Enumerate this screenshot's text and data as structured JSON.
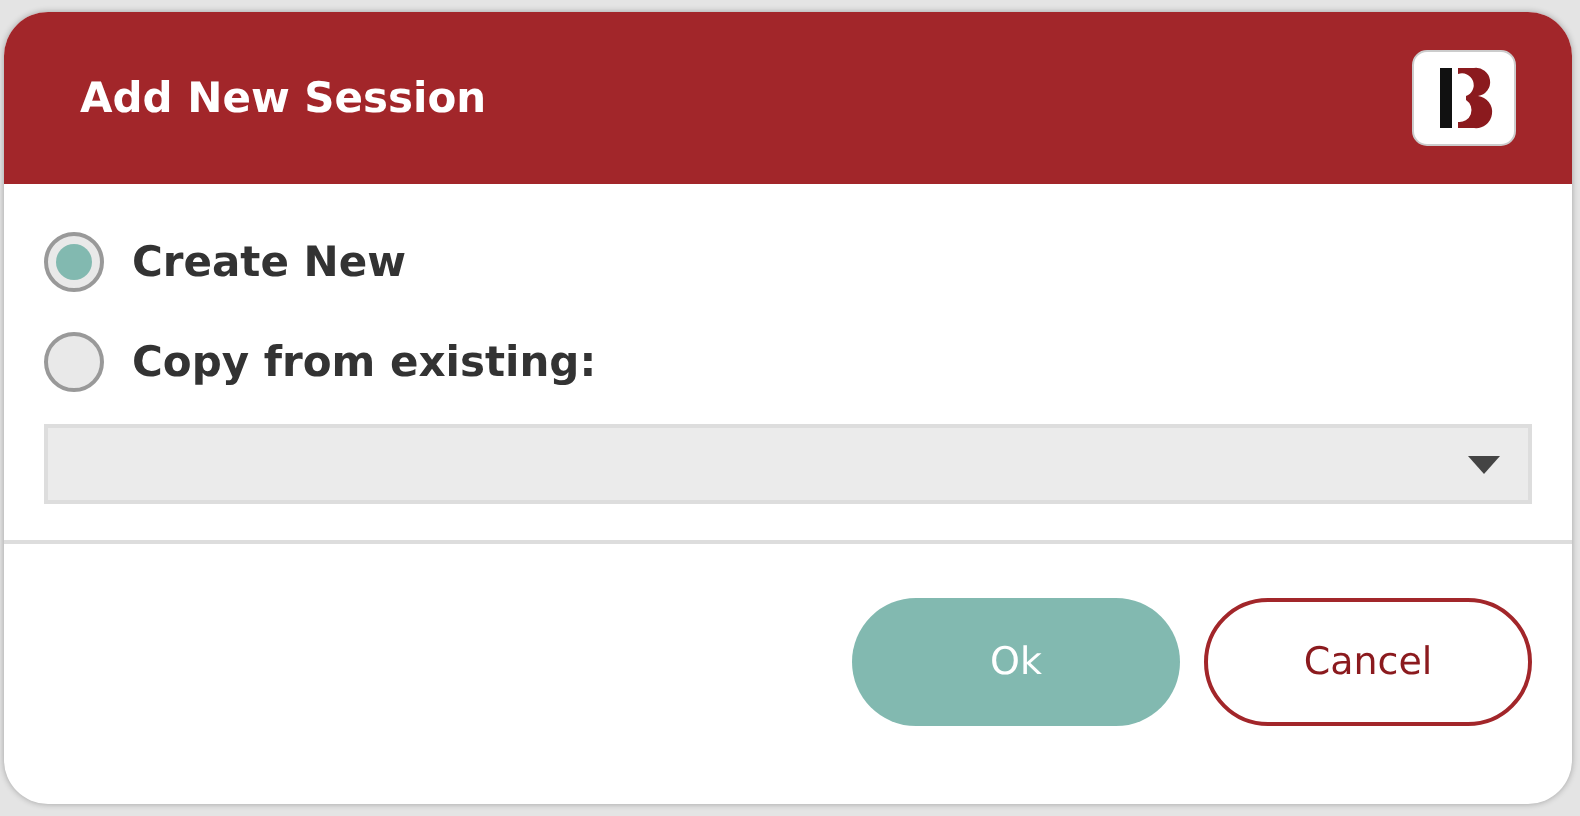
{
  "dialog": {
    "title": "Add New Session"
  },
  "options": [
    {
      "label": "Create New",
      "selected": true
    },
    {
      "label": "Copy from existing:",
      "selected": false
    }
  ],
  "session_select": {
    "disabled": true
  },
  "buttons": [
    {
      "label": "Ok",
      "kind": "primary"
    },
    {
      "label": "Cancel",
      "kind": "secondary"
    }
  ]
}
